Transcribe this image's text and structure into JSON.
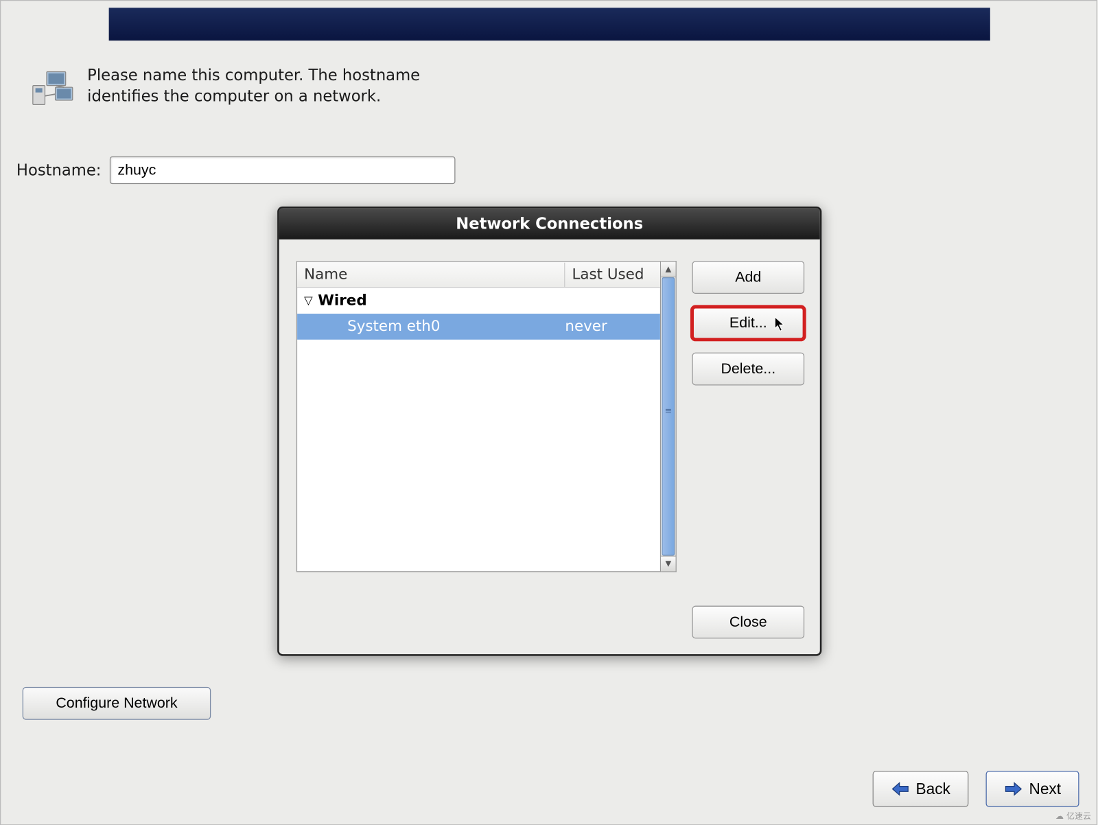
{
  "intro": {
    "text": "Please name this computer.  The hostname identifies the computer on a network."
  },
  "hostname": {
    "label": "Hostname:",
    "value": "zhuyc"
  },
  "configure_network_label": "Configure Network",
  "dialog": {
    "title": "Network Connections",
    "columns": {
      "name": "Name",
      "last_used": "Last Used"
    },
    "group": "Wired",
    "item": {
      "name": "System eth0",
      "last_used": "never"
    },
    "buttons": {
      "add": "Add",
      "edit": "Edit...",
      "delete": "Delete...",
      "close": "Close"
    }
  },
  "nav": {
    "back": "Back",
    "next": "Next"
  },
  "watermark": "亿速云"
}
